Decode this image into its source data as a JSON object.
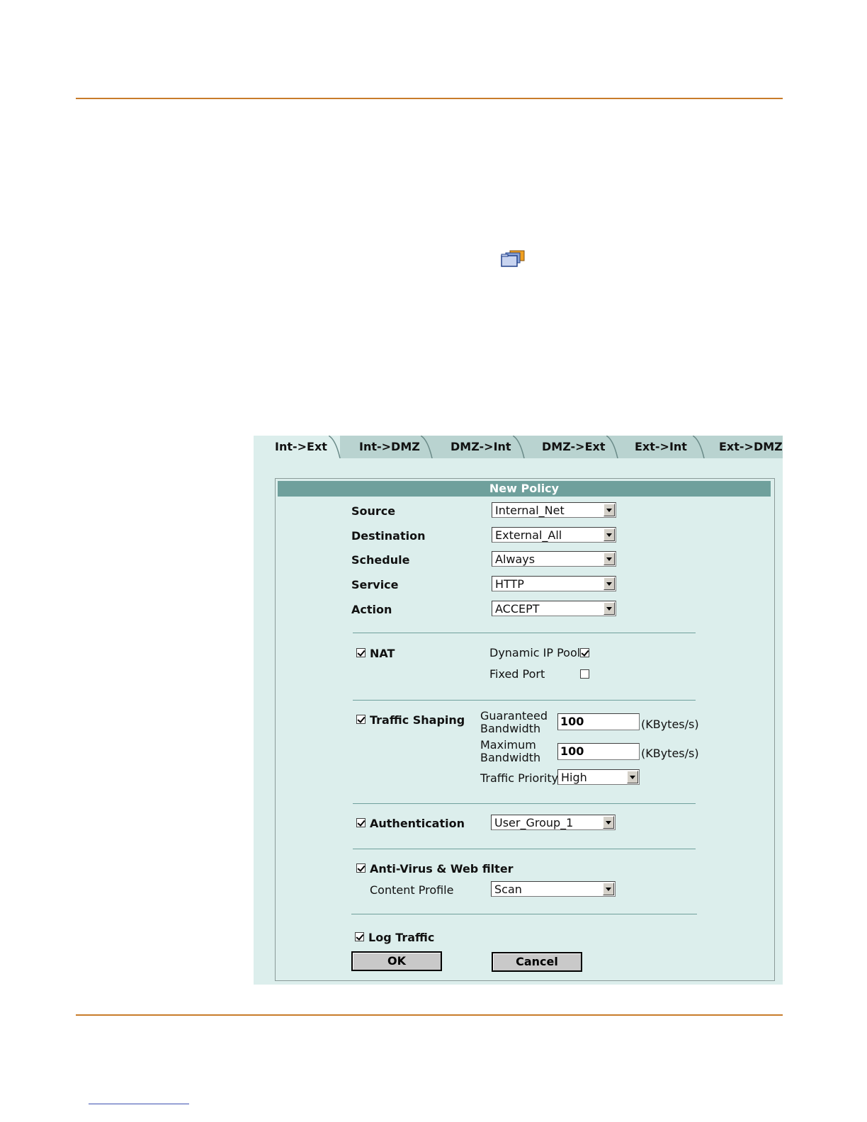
{
  "tabs": [
    "Int->Ext",
    "Int->DMZ",
    "DMZ->Int",
    "DMZ->Ext",
    "Ext->Int",
    "Ext->DMZ"
  ],
  "active_tab": "Int->Ext",
  "form": {
    "title": "New Policy",
    "source_label": "Source",
    "source_value": "Internal_Net",
    "destination_label": "Destination",
    "destination_value": "External_All",
    "schedule_label": "Schedule",
    "schedule_value": "Always",
    "service_label": "Service",
    "service_value": "HTTP",
    "action_label": "Action",
    "action_value": "ACCEPT",
    "nat_label": "NAT",
    "nat_checked": true,
    "dynamic_ip_pool_label": "Dynamic IP Pool",
    "dynamic_ip_pool_checked": true,
    "fixed_port_label": "Fixed Port",
    "fixed_port_checked": false,
    "traffic_shaping_label": "Traffic Shaping",
    "traffic_shaping_checked": true,
    "guaranteed_bw_label_1": "Guaranteed",
    "guaranteed_bw_label_2": "Bandwidth",
    "guaranteed_bw_value": "100",
    "maximum_bw_label_1": "Maximum",
    "maximum_bw_label_2": "Bandwidth",
    "maximum_bw_value": "100",
    "bw_unit": "(KBytes/s)",
    "traffic_priority_label": "Traffic Priority",
    "traffic_priority_value": "High",
    "authentication_label": "Authentication",
    "authentication_checked": true,
    "authentication_value": "User_Group_1",
    "antivirus_label": "Anti-Virus & Web filter",
    "antivirus_checked": true,
    "content_profile_label": "Content Profile",
    "content_profile_value": "Scan",
    "log_traffic_label": "Log Traffic",
    "log_traffic_checked": true,
    "ok_label": "OK",
    "cancel_label": "Cancel"
  },
  "colors": {
    "rule": "#c87c2a",
    "panel_bg": "#dceeec",
    "header_bg": "#6fa09c"
  },
  "icons": [
    "folder-icon"
  ]
}
